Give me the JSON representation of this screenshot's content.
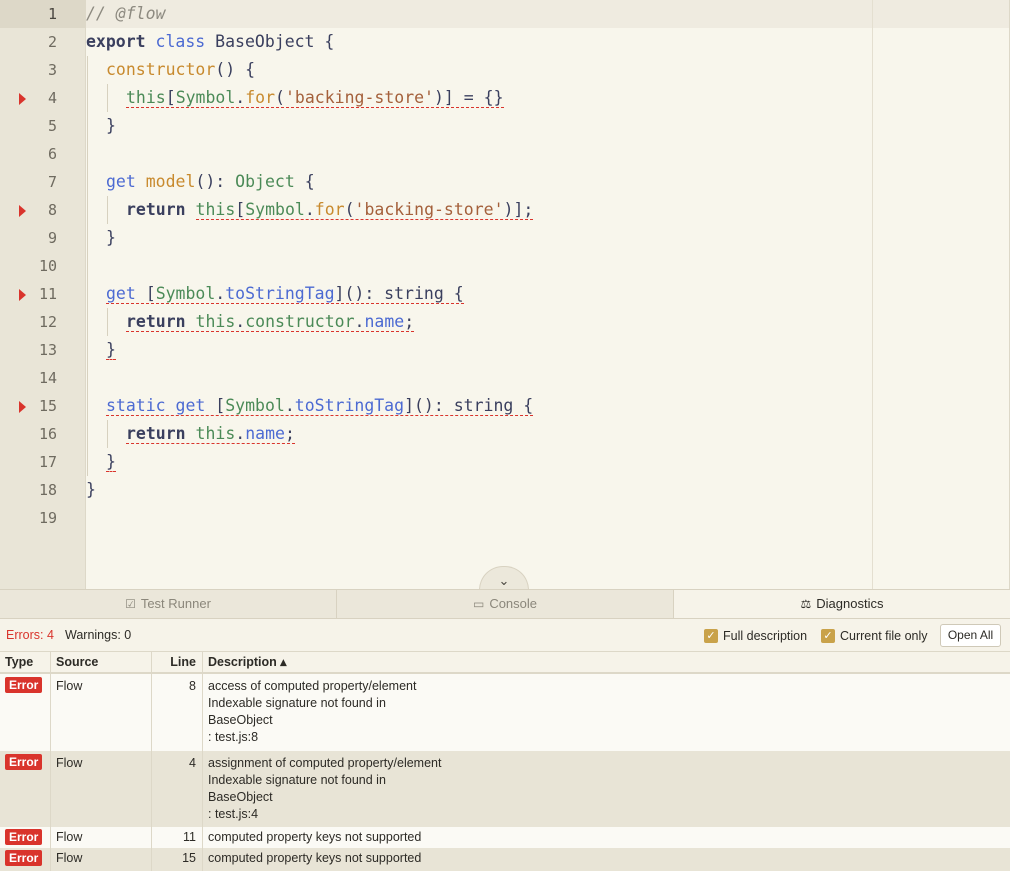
{
  "editor": {
    "lines": [
      {
        "n": "1",
        "marker": false,
        "active": true
      },
      {
        "n": "2",
        "marker": false
      },
      {
        "n": "3",
        "marker": false
      },
      {
        "n": "4",
        "marker": true
      },
      {
        "n": "5",
        "marker": false
      },
      {
        "n": "6",
        "marker": false
      },
      {
        "n": "7",
        "marker": false
      },
      {
        "n": "8",
        "marker": true
      },
      {
        "n": "9",
        "marker": false
      },
      {
        "n": "10",
        "marker": false
      },
      {
        "n": "11",
        "marker": true
      },
      {
        "n": "12",
        "marker": false
      },
      {
        "n": "13",
        "marker": false
      },
      {
        "n": "14",
        "marker": false
      },
      {
        "n": "15",
        "marker": true
      },
      {
        "n": "16",
        "marker": false
      },
      {
        "n": "17",
        "marker": false
      },
      {
        "n": "18",
        "marker": false
      },
      {
        "n": "19",
        "marker": false
      }
    ],
    "code": {
      "l1": "// @flow",
      "l2_kw": "export",
      "l2_kw2": "class",
      "l2_name": "BaseObject {",
      "l3_fn": "constructor",
      "l3_rest": "() {",
      "l4_this": "this",
      "l4_a": "[",
      "l4_sym": "Symbol",
      "l4_dot": ".",
      "l4_for": "for",
      "l4_b": "(",
      "l4_str": "'backing-store'",
      "l4_c": ")] = {}",
      "l5": "}",
      "l7_get": "get",
      "l7_fn": "model",
      "l7_a": "(): ",
      "l7_type": "Object",
      "l7_b": " {",
      "l8_ret": "return",
      "l8_this": "this",
      "l8_a": "[",
      "l8_sym": "Symbol",
      "l8_dot": ".",
      "l8_for": "for",
      "l8_b": "(",
      "l8_str": "'backing-store'",
      "l8_c": ")];",
      "l9": "}",
      "l11_get": "get",
      "l11_a": " [",
      "l11_sym": "Symbol",
      "l11_dot": ".",
      "l11_tag": "toStringTag",
      "l11_b": "](): string {",
      "l12_ret": "return",
      "l12_this": "this",
      "l12_dot": ".",
      "l12_ctor": "constructor",
      "l12_dot2": ".",
      "l12_name": "name",
      "l12_semi": ";",
      "l13": "}",
      "l15_static": "static",
      "l15_get": "get",
      "l15_a": " [",
      "l15_sym": "Symbol",
      "l15_dot": ".",
      "l15_tag": "toStringTag",
      "l15_b": "](): string {",
      "l16_ret": "return",
      "l16_this": "this",
      "l16_dot": ".",
      "l16_name": "name",
      "l16_semi": ";",
      "l17": "}",
      "l18": "}"
    },
    "collapse_icon": "chevron-down-icon",
    "collapse_glyph": "⌄"
  },
  "tabs": [
    {
      "label": "Test Runner",
      "icon": "test-runner-icon",
      "glyph": "☑"
    },
    {
      "label": "Console",
      "icon": "console-icon",
      "glyph": "▭"
    },
    {
      "label": "Diagnostics",
      "icon": "scale-icon",
      "glyph": "⚖"
    }
  ],
  "toolbar": {
    "errors": "Errors: 4",
    "warnings": "Warnings: 0",
    "full_description": "Full description",
    "current_file_only": "Current file only",
    "check_glyph": "✓",
    "open_all": "Open All"
  },
  "table": {
    "headers": {
      "type": "Type",
      "source": "Source",
      "line": "Line",
      "description": "Description ▴"
    },
    "rows": [
      {
        "type": "Error",
        "source": "Flow",
        "line": "8",
        "desc": [
          "access of computed property/element",
          "Indexable signature not found in",
          "BaseObject",
          ": test.js:8"
        ]
      },
      {
        "type": "Error",
        "source": "Flow",
        "line": "4",
        "desc": [
          "assignment of computed property/element",
          "Indexable signature not found in",
          "BaseObject",
          ": test.js:4"
        ]
      },
      {
        "type": "Error",
        "source": "Flow",
        "line": "11",
        "desc": [
          "computed property keys not supported"
        ]
      },
      {
        "type": "Error",
        "source": "Flow",
        "line": "15",
        "desc": [
          "computed property keys not supported"
        ]
      }
    ]
  },
  "colors": {
    "error": "#d9342c",
    "accent": "#c9a24a"
  }
}
